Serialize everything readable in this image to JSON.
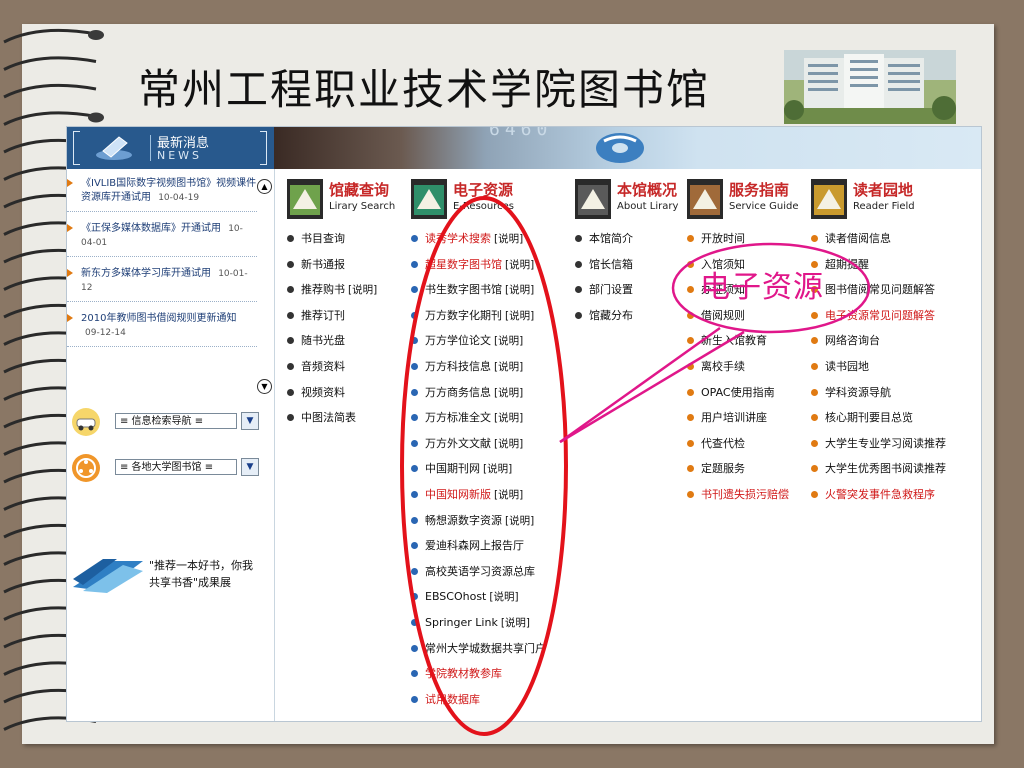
{
  "slide_title": "常州工程职业技术学院图书馆",
  "news_panel": {
    "title_zh": "最新消息",
    "title_en": "NEWS",
    "items": [
      {
        "text": "《IVLIB国际数字视频图书馆》视频课件资源库开通试用",
        "date": "10-04-19"
      },
      {
        "text": "《正保多媒体数据库》开通试用",
        "date": "10-04-01"
      },
      {
        "text": "新东方多媒体学习库开通试用",
        "date": "10-01-12"
      },
      {
        "text": "2010年教师图书借阅规则更新通知",
        "date": "09-12-14"
      }
    ],
    "scroll_up": "▲",
    "scroll_down": "▼"
  },
  "selects": [
    {
      "value": "≡ 信息检索导航 ≡"
    },
    {
      "value": "≡ 各地大学图书馆 ≡"
    }
  ],
  "promo_text": "\"推荐一本好书，你我共享书香\"成果展",
  "banner_code": "6460",
  "categories": [
    {
      "zh": "馆藏查询",
      "en": "Lirary Search",
      "items": [
        {
          "text": "书目查询"
        },
        {
          "text": "新书通报"
        },
        {
          "text": "推荐购书",
          "note": "[说明]"
        },
        {
          "text": "推荐订刊"
        },
        {
          "text": "随书光盘"
        },
        {
          "text": "音频资料"
        },
        {
          "text": "视频资料"
        },
        {
          "text": "中图法简表"
        }
      ]
    },
    {
      "zh": "电子资源",
      "en": "E-Resources",
      "items": [
        {
          "text": "读秀学术搜索",
          "note": "[说明]",
          "red": true
        },
        {
          "text": "超星数字图书馆",
          "note": "[说明]",
          "red": true
        },
        {
          "text": "书生数字图书馆",
          "note": "[说明]"
        },
        {
          "text": "万方数字化期刊",
          "note": "[说明]"
        },
        {
          "text": "万方学位论文",
          "note": "[说明]"
        },
        {
          "text": "万方科技信息",
          "note": "[说明]"
        },
        {
          "text": "万方商务信息",
          "note": "[说明]"
        },
        {
          "text": "万方标准全文",
          "note": "[说明]"
        },
        {
          "text": "万方外文文献",
          "note": "[说明]"
        },
        {
          "text": "中国期刊网",
          "note": "[说明]"
        },
        {
          "text": "中国知网新版",
          "note": "[说明]",
          "red": true
        },
        {
          "text": "畅想源数字资源",
          "note": "[说明]"
        },
        {
          "text": "爱迪科森网上报告厅"
        },
        {
          "text": "高校英语学习资源总库"
        },
        {
          "text": "EBSCOhost",
          "note": "[说明]"
        },
        {
          "text": "Springer Link",
          "note": "[说明]"
        },
        {
          "text": "常州大学城数据共享门户"
        },
        {
          "text": "学院教材教参库",
          "red": true
        },
        {
          "text": "试用数据库",
          "red": true
        }
      ]
    },
    {
      "zh": "本馆概况",
      "en": "About Lirary",
      "items": [
        {
          "text": "本馆简介"
        },
        {
          "text": "馆长信箱"
        },
        {
          "text": "部门设置"
        },
        {
          "text": "馆藏分布"
        }
      ]
    },
    {
      "zh": "服务指南",
      "en": "Service Guide",
      "items": [
        {
          "text": "开放时间"
        },
        {
          "text": "入馆须知"
        },
        {
          "text": "办证须知"
        },
        {
          "text": "借阅规则"
        },
        {
          "text": "新生入馆教育"
        },
        {
          "text": "离校手续"
        },
        {
          "text": "OPAC使用指南"
        },
        {
          "text": "用户培训讲座"
        },
        {
          "text": "代查代检"
        },
        {
          "text": "定题服务"
        },
        {
          "text": "书刊遗失损污赔偿",
          "red": true
        }
      ]
    },
    {
      "zh": "读者园地",
      "en": "Reader Field",
      "items": [
        {
          "text": "读者借阅信息"
        },
        {
          "text": "超期提醒"
        },
        {
          "text": "图书借阅常见问题解答"
        },
        {
          "text": "电子资源常见问题解答",
          "red": true
        },
        {
          "text": "网络咨询台"
        },
        {
          "text": "读书园地"
        },
        {
          "text": "学科资源导航"
        },
        {
          "text": "核心期刊要目总览"
        },
        {
          "text": "大学生专业学习阅读推荐"
        },
        {
          "text": "大学生优秀图书阅读推荐"
        },
        {
          "text": "火警突发事件急救程序",
          "red": true
        }
      ]
    }
  ],
  "annotation_label": "电子资源",
  "colors": {
    "background": "#8a7765",
    "paper": "#ecebe6",
    "news_header": "#28598d",
    "category_title": "#c62828",
    "highlight_red": "#d01818",
    "callout_magenta": "#e0178a",
    "oval_red": "#e3121b"
  }
}
